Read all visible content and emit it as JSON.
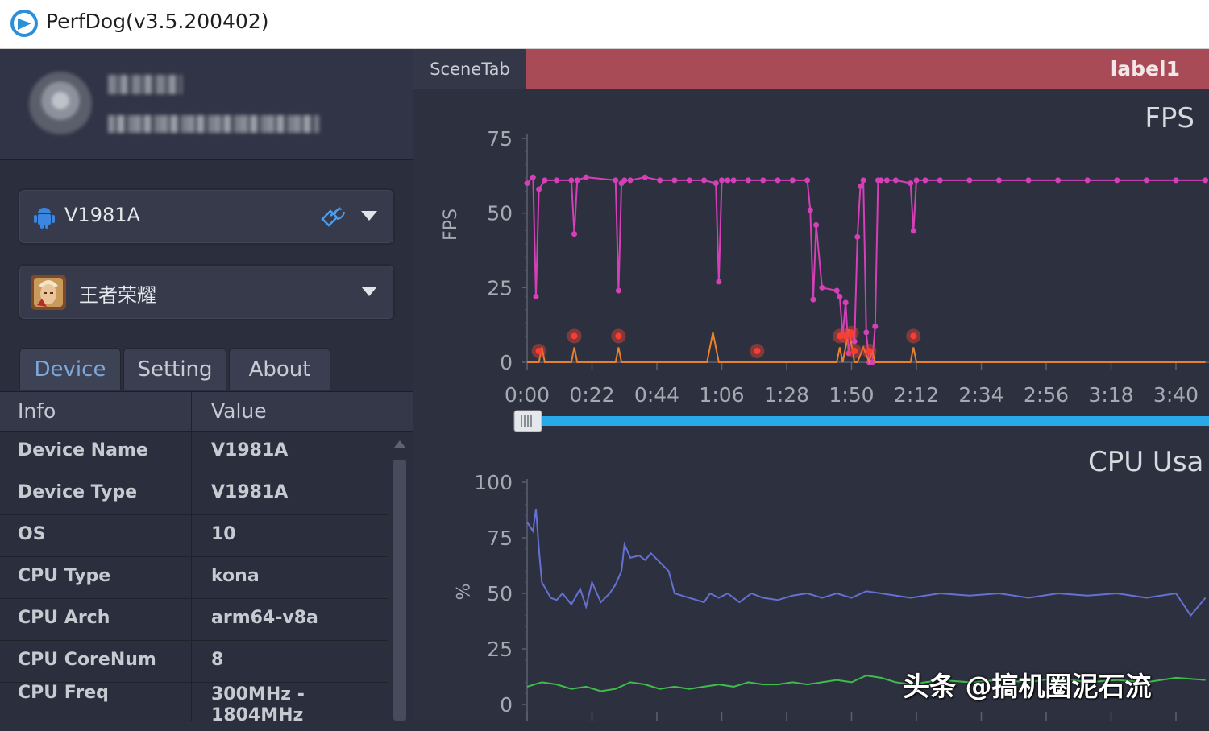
{
  "window": {
    "title": "PerfDog(v3.5.200402)"
  },
  "device_selector": {
    "name": "V1981A"
  },
  "app_selector": {
    "name": "王者荣耀"
  },
  "tabs": [
    {
      "label": "Device"
    },
    {
      "label": "Setting"
    },
    {
      "label": "About"
    }
  ],
  "info_table": {
    "headers": {
      "info": "Info",
      "value": "Value"
    },
    "rows": [
      {
        "key": "Device Name",
        "value": "V1981A"
      },
      {
        "key": "Device Type",
        "value": "V1981A"
      },
      {
        "key": "OS",
        "value": "10"
      },
      {
        "key": "CPU Type",
        "value": "kona"
      },
      {
        "key": "CPU Arch",
        "value": "arm64-v8a"
      },
      {
        "key": "CPU CoreNum",
        "value": "8"
      },
      {
        "key": "CPU Freq",
        "value": "300MHz - 1804MHz"
      }
    ]
  },
  "scene_tab": {
    "label": "SceneTab",
    "marker": "label1"
  },
  "colors": {
    "accent": "#29a8ea",
    "label_bar": "#a84b57",
    "fps_line": "#d53fb8",
    "jank_line": "#e8812e",
    "cpu_app": "#6470d2",
    "cpu_other": "#3fbd4b"
  },
  "watermark": "头条 @搞机圈泥石流",
  "chart_data": [
    {
      "type": "line",
      "title": "FPS",
      "ylabel": "FPS",
      "ylim": [
        0,
        75
      ],
      "yticks": [
        "75",
        "50",
        "25",
        "0"
      ],
      "xticks": [
        "0:00",
        "0:22",
        "0:44",
        "1:06",
        "1:28",
        "1:50",
        "2:12",
        "2:34",
        "2:56",
        "3:18",
        "3:40"
      ],
      "grid": false,
      "series": [
        {
          "x": [
            0,
            2,
            3,
            4,
            6,
            10,
            15,
            16,
            17,
            20,
            30,
            31,
            32,
            33,
            35,
            40,
            45,
            50,
            55,
            60,
            64,
            65,
            66,
            68,
            70,
            75,
            80,
            85,
            90,
            95,
            96,
            97,
            98,
            100,
            105,
            106,
            107,
            108,
            109,
            110,
            111,
            112,
            113,
            114,
            115,
            116,
            117,
            118,
            119,
            120,
            122,
            125,
            130,
            131,
            132,
            135,
            140,
            150,
            160,
            170,
            180,
            190,
            200,
            210,
            220,
            230
          ],
          "y": [
            60,
            62,
            22,
            58,
            61,
            61,
            61,
            43,
            61,
            62,
            61,
            24,
            60,
            61,
            61,
            62,
            61,
            61,
            61,
            61,
            60,
            27,
            61,
            61,
            61,
            61,
            61,
            61,
            61,
            61,
            51,
            21,
            46,
            25,
            24,
            22,
            9,
            20,
            3,
            10,
            7,
            42,
            59,
            61,
            10,
            0,
            0,
            12,
            61,
            61,
            61,
            61,
            60,
            44,
            61,
            61,
            61,
            61,
            61,
            61,
            61,
            61,
            61,
            61,
            61,
            61
          ]
        },
        {
          "x": [
            0,
            4,
            5,
            6,
            15,
            16,
            17,
            30,
            31,
            32,
            61,
            63,
            65,
            105,
            106,
            107,
            108,
            109,
            110,
            111,
            112,
            114,
            116,
            117,
            118,
            130,
            131,
            132,
            230
          ],
          "y": [
            0,
            0,
            5,
            0,
            0,
            5,
            0,
            0,
            5,
            0,
            0,
            10,
            0,
            0,
            5,
            0,
            5,
            11,
            6,
            0,
            0,
            5,
            0,
            4,
            0,
            0,
            5,
            0,
            0
          ]
        }
      ],
      "jank_points_x": [
        4,
        16,
        31,
        78,
        106,
        108,
        110,
        111,
        116,
        131
      ]
    },
    {
      "type": "line",
      "title": "CPU Usa",
      "ylabel": "%",
      "ylim": [
        0,
        100
      ],
      "yticks": [
        "100",
        "75",
        "50",
        "25",
        "0"
      ],
      "grid": false,
      "series": [
        {
          "x": [
            0,
            2,
            3,
            4,
            5,
            8,
            10,
            12,
            15,
            18,
            20,
            22,
            25,
            28,
            30,
            32,
            33,
            35,
            38,
            40,
            42,
            45,
            48,
            50,
            55,
            60,
            62,
            65,
            68,
            72,
            76,
            80,
            85,
            90,
            95,
            100,
            105,
            110,
            115,
            120,
            130,
            140,
            150,
            160,
            170,
            180,
            190,
            200,
            210,
            220,
            225,
            230
          ],
          "y": [
            82,
            78,
            88,
            70,
            55,
            48,
            47,
            50,
            45,
            52,
            44,
            55,
            46,
            50,
            54,
            60,
            72,
            66,
            67,
            65,
            68,
            64,
            60,
            50,
            48,
            46,
            50,
            48,
            50,
            46,
            50,
            48,
            47,
            49,
            50,
            48,
            50,
            48,
            51,
            50,
            48,
            50,
            49,
            50,
            48,
            50,
            49,
            50,
            48,
            50,
            40,
            48
          ]
        },
        {
          "x": [
            0,
            5,
            10,
            15,
            20,
            25,
            30,
            35,
            40,
            45,
            50,
            55,
            60,
            65,
            70,
            75,
            80,
            85,
            90,
            95,
            100,
            105,
            110,
            115,
            120,
            125,
            130,
            135,
            140,
            150,
            160,
            170,
            180,
            190,
            200,
            210,
            220,
            230
          ],
          "y": [
            8,
            10,
            9,
            7,
            8,
            6,
            7,
            10,
            9,
            7,
            8,
            7,
            8,
            9,
            8,
            10,
            9,
            9,
            10,
            9,
            10,
            11,
            10,
            13,
            12,
            10,
            9,
            10,
            11,
            10,
            11,
            10,
            12,
            10,
            11,
            10,
            12,
            11
          ]
        }
      ]
    }
  ]
}
